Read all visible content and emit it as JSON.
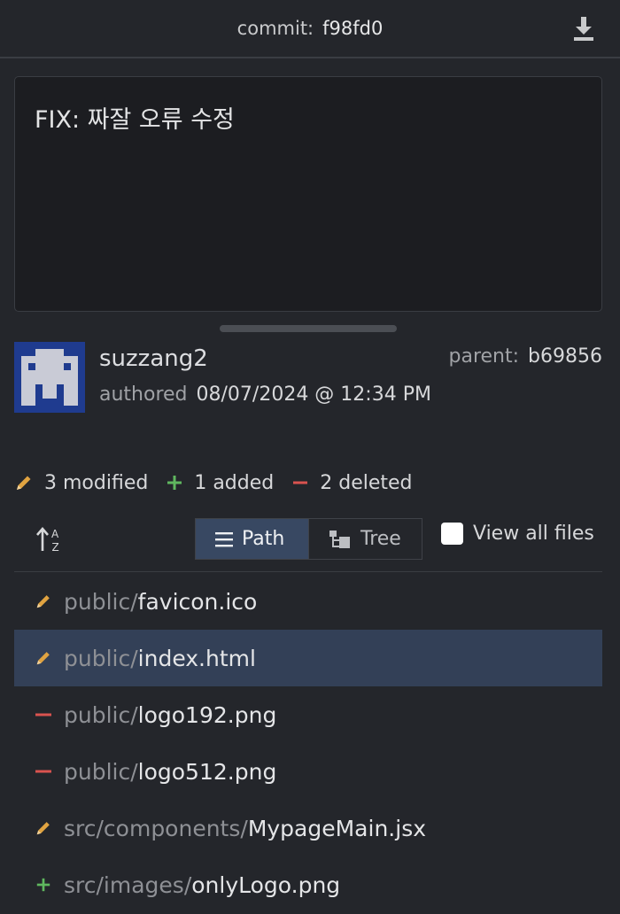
{
  "header": {
    "commit_label": "commit:",
    "commit_sha": "f98fd0",
    "download_icon": "download-icon"
  },
  "commit_message": "FIX: 짜잘 오류 수정",
  "author": {
    "name": "suzzang2",
    "authored_label": "authored",
    "date": "08/07/2024 @ 12:34 PM",
    "avatar_colors": {
      "background": "#1f3b8f",
      "foreground": "#c9cbd6"
    }
  },
  "parent": {
    "label": "parent:",
    "sha": "b69856"
  },
  "stats": {
    "modified": "3 modified",
    "added": "1 added",
    "deleted": "2 deleted"
  },
  "view_toggle": {
    "sort_icon": "sort-alpha-icon",
    "path_label": "Path",
    "tree_label": "Tree",
    "view_all_label": "View all files",
    "view_all_checked": false
  },
  "files": [
    {
      "status": "modified",
      "dir": "public/",
      "name": "favicon.ico"
    },
    {
      "status": "modified",
      "dir": "public/",
      "name": "index.html",
      "selected": true
    },
    {
      "status": "deleted",
      "dir": "public/",
      "name": "logo192.png"
    },
    {
      "status": "deleted",
      "dir": "public/",
      "name": "logo512.png"
    },
    {
      "status": "modified",
      "dir": "src/components/",
      "name": "MypageMain.jsx"
    },
    {
      "status": "added",
      "dir": "src/images/",
      "name": "onlyLogo.png"
    }
  ],
  "colors": {
    "modified": "#e0a341",
    "added": "#5fb75f",
    "deleted": "#d9534f",
    "selected_row": "#334057",
    "active_segment": "#384862"
  }
}
